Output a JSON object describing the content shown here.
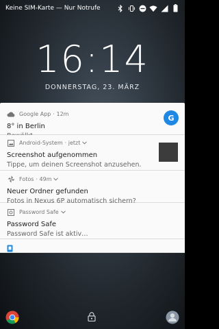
{
  "status_bar": {
    "carrier": "Keine SIM-Karte — Nur Notrufe",
    "icons": [
      "bluetooth-icon",
      "vibrate-icon",
      "dnd-icon",
      "wifi-icon",
      "signal-icon",
      "battery-icon"
    ]
  },
  "lockscreen": {
    "time": "16:14",
    "date": "DONNERSTAG, 23. MÄRZ"
  },
  "notifications": [
    {
      "app": "Google App",
      "time": "· 12m",
      "title": "8° in Berlin",
      "text": "Bewölkt",
      "badge": "G"
    },
    {
      "app": "Android-System",
      "time": "· jetzt",
      "title": "Screenshot aufgenommen",
      "text": "Tippe, um deinen Screenshot anzusehen."
    },
    {
      "app": "Fotos",
      "time": "· 49m",
      "title": "Neuer Ordner gefunden",
      "text": "Fotos in Nexus 6P automatisch sichern?"
    },
    {
      "app": "Password Safe",
      "time": "",
      "title": "Password Safe",
      "text": "Password Safe ist aktiv…"
    }
  ],
  "bottom": {
    "left_icon": "chrome-icon",
    "center_icon": "lock-icon",
    "right_icon": "user-icon"
  },
  "colors": {
    "accent_blue": "#1e88e5",
    "card_bg": "#fafafa"
  }
}
